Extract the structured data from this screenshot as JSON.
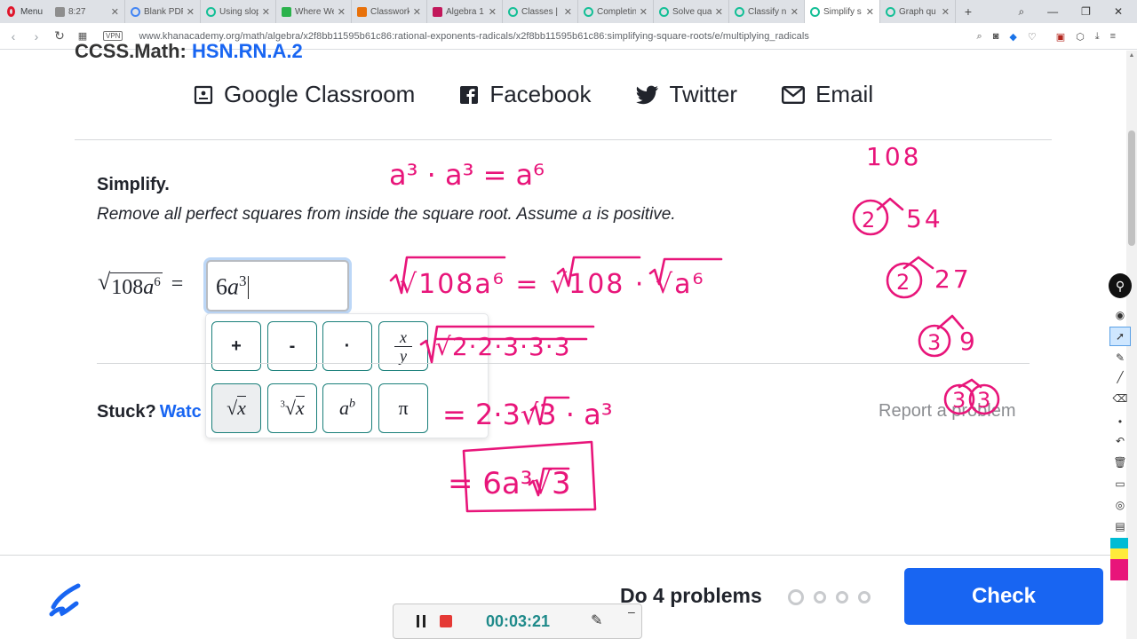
{
  "browser": {
    "menu_label": "Menu",
    "tabs": [
      {
        "title": "8:27",
        "active": false
      },
      {
        "title": "Blank PDF",
        "active": false
      },
      {
        "title": "Using slop",
        "active": false
      },
      {
        "title": "Where We",
        "active": false
      },
      {
        "title": "Classwork",
        "active": false
      },
      {
        "title": "Algebra 1",
        "active": false
      },
      {
        "title": "Classes | K",
        "active": false
      },
      {
        "title": "Completin",
        "active": false
      },
      {
        "title": "Solve qua",
        "active": false
      },
      {
        "title": "Classify nu",
        "active": false
      },
      {
        "title": "Simplify s",
        "active": true
      },
      {
        "title": "Graph qu",
        "active": false
      }
    ],
    "new_tab": "+",
    "vpn_badge": "VPN",
    "url": "www.khanacademy.org/math/algebra/x2f8bb11595b61c86:rational-exponents-radicals/x2f8bb11595b61c86:simplifying-square-roots/e/multiplying_radicals"
  },
  "page": {
    "course_cut": "CCSS.Math:",
    "course_code": "HSN.RN.A.2",
    "share": [
      {
        "label": "Google Classroom",
        "icon": "google-classroom-icon"
      },
      {
        "label": "Facebook",
        "icon": "facebook-icon"
      },
      {
        "label": "Twitter",
        "icon": "twitter-icon"
      },
      {
        "label": "Email",
        "icon": "email-icon"
      }
    ],
    "problem": {
      "heading": "Simplify.",
      "instruction_prefix": "Remove all perfect squares from inside the square root. Assume ",
      "instruction_var": "a",
      "instruction_suffix": " is positive.",
      "radicand": "108",
      "radicand_var": "a",
      "radicand_exp": "6",
      "equals": "=",
      "answer_coef": "6",
      "answer_var": "a",
      "answer_exp": "3"
    },
    "keypad": {
      "keys": [
        "+",
        "-",
        "·",
        "x/y",
        "√x",
        "∛x",
        "aᵇ",
        "π"
      ]
    },
    "stuck": {
      "label": "Stuck?",
      "link": "Watc"
    },
    "report": "Report a problem",
    "do_problems": "Do 4 problems",
    "problems_total": 4,
    "problems_done": 0,
    "check_label": "Check"
  },
  "recorder": {
    "time": "00:03:21"
  },
  "ink": {
    "color": "#e8157a",
    "line1": "a³ · a³ = a⁶",
    "line2": "√108a⁶ = √108 · √a⁶",
    "line3": "√2·2·3·3·3",
    "line4": "= 2·3√3 · a³",
    "line5": "= 6a³√3",
    "tree": [
      "108",
      "2",
      "54",
      "2",
      "27",
      "3",
      "9",
      "3",
      "3"
    ]
  },
  "colors": {
    "primary": "#1865f2",
    "teal": "#1a7f7a",
    "ink": "#e8157a"
  }
}
